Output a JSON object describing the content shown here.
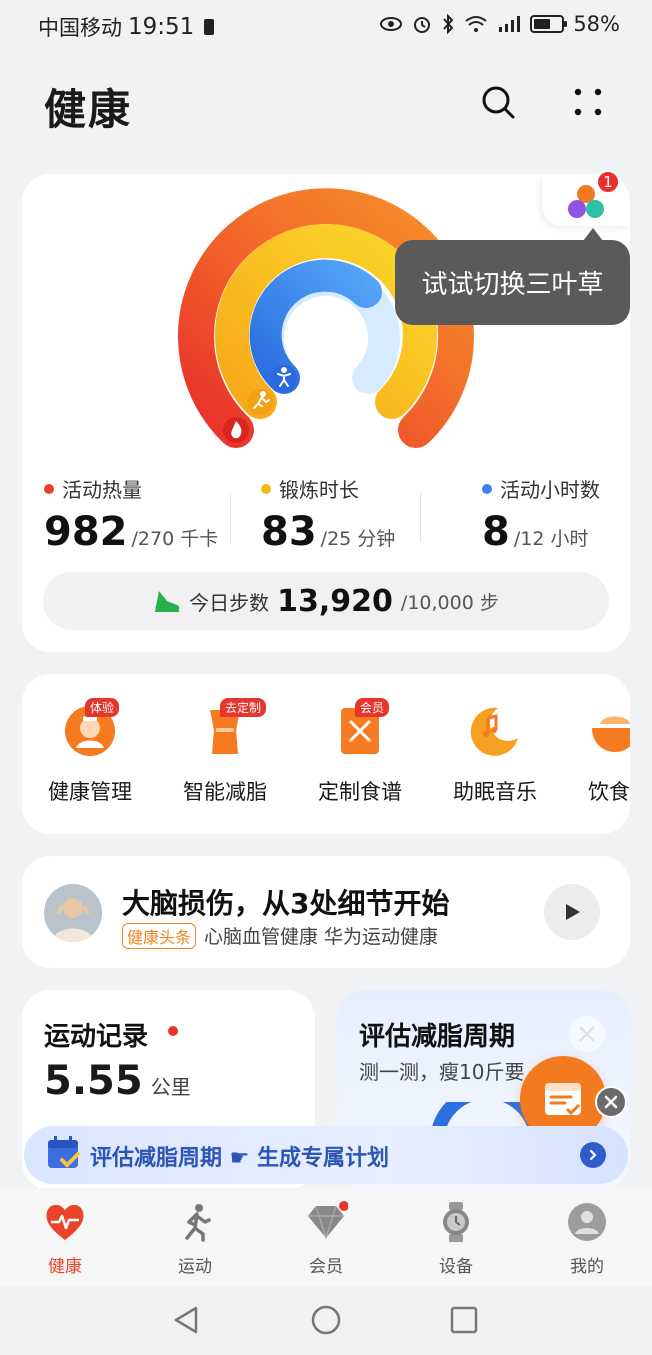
{
  "status": {
    "carrier": "中国移动",
    "time": "19:51",
    "battery": "58%"
  },
  "header": {
    "title": "健康"
  },
  "rings": {
    "tooltip": "试试切换三叶草",
    "badge": "1",
    "metrics": [
      {
        "label": "活动热量",
        "value": "982",
        "goal": "/270 千卡",
        "color": "#e8402a"
      },
      {
        "label": "锻炼时长",
        "value": "83",
        "goal": "/25 分钟",
        "color": "#f4b816"
      },
      {
        "label": "活动小时数",
        "value": "8",
        "goal": "/12 小时",
        "color": "#3d82f0"
      }
    ],
    "steps": {
      "label": "今日步数",
      "value": "13,920",
      "goal": "/10,000 步"
    }
  },
  "services": [
    {
      "name": "健康管理",
      "tag": "体验"
    },
    {
      "name": "智能减脂",
      "tag": "去定制"
    },
    {
      "name": "定制食谱",
      "tag": "会员"
    },
    {
      "name": "助眠音乐",
      "tag": ""
    },
    {
      "name": "饮食",
      "tag": ""
    }
  ],
  "news": {
    "title": "大脑损伤，从3处细节开始",
    "tag": "健康头条",
    "source": "心脑血管健康 华为运动健康"
  },
  "sport_record": {
    "title": "运动记录",
    "value": "5.55",
    "unit": "公里"
  },
  "fat_cycle": {
    "title": "评估减脂周期",
    "subtitle": "测一测，瘦10斤要"
  },
  "banner": {
    "text": "评估减脂周期 ☛ 生成专属计划"
  },
  "tabs": [
    {
      "label": "健康"
    },
    {
      "label": "运动"
    },
    {
      "label": "会员"
    },
    {
      "label": "设备"
    },
    {
      "label": "我的"
    }
  ]
}
